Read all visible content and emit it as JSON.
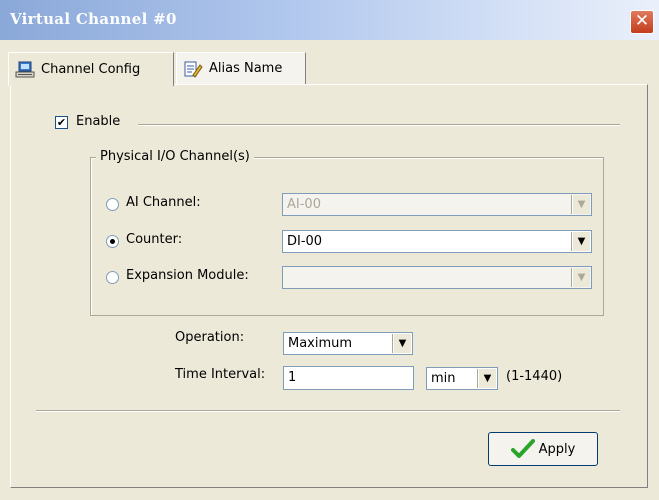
{
  "window": {
    "title": "Virtual Channel #0",
    "close_symbol": "✕"
  },
  "tabs": [
    {
      "label": "Channel Config",
      "icon": "monitor-config-icon"
    },
    {
      "label": "Alias Name",
      "icon": "notepad-edit-icon"
    }
  ],
  "enable": {
    "label": "Enable",
    "checked": true,
    "check_mark": "✔"
  },
  "physical_group": {
    "title": "Physical I/O Channel(s)",
    "rows": [
      {
        "label": "AI Channel:",
        "value": "AI-00",
        "selected": false,
        "enabled": false
      },
      {
        "label": "Counter:",
        "value": "DI-00",
        "selected": true,
        "enabled": true
      },
      {
        "label": "Expansion Module:",
        "value": "",
        "selected": false,
        "enabled": false
      }
    ]
  },
  "operation": {
    "label": "Operation:",
    "value": "Maximum"
  },
  "time_interval": {
    "label": "Time Interval:",
    "value": "1",
    "unit": "min",
    "range": "(1-1440)"
  },
  "apply_button": {
    "label": "Apply",
    "icon": "green-checkmark-icon"
  },
  "colors": {
    "accent_check": "#2aa52a",
    "title_bar": "#8aa8d8",
    "close_red": "#c43c1c"
  }
}
